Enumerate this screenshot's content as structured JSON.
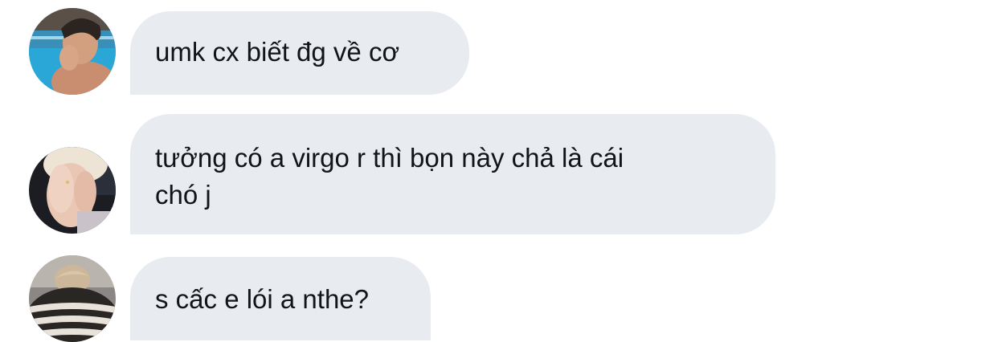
{
  "messages": [
    {
      "avatar": "avatar-pool-boy",
      "lines": [
        "umk cx biết đg về cơ"
      ]
    },
    {
      "avatar": "avatar-hands-face",
      "lines": [
        "tưởng có a virgo r thì bọn này chả là cái",
        "chó j"
      ]
    },
    {
      "avatar": "avatar-striped-sweater",
      "lines": [
        "s cấc e lói a nthe?"
      ]
    }
  ],
  "colors": {
    "bubble_bg": "#e8ecf0",
    "text": "#111418",
    "background": "#ffffff"
  }
}
